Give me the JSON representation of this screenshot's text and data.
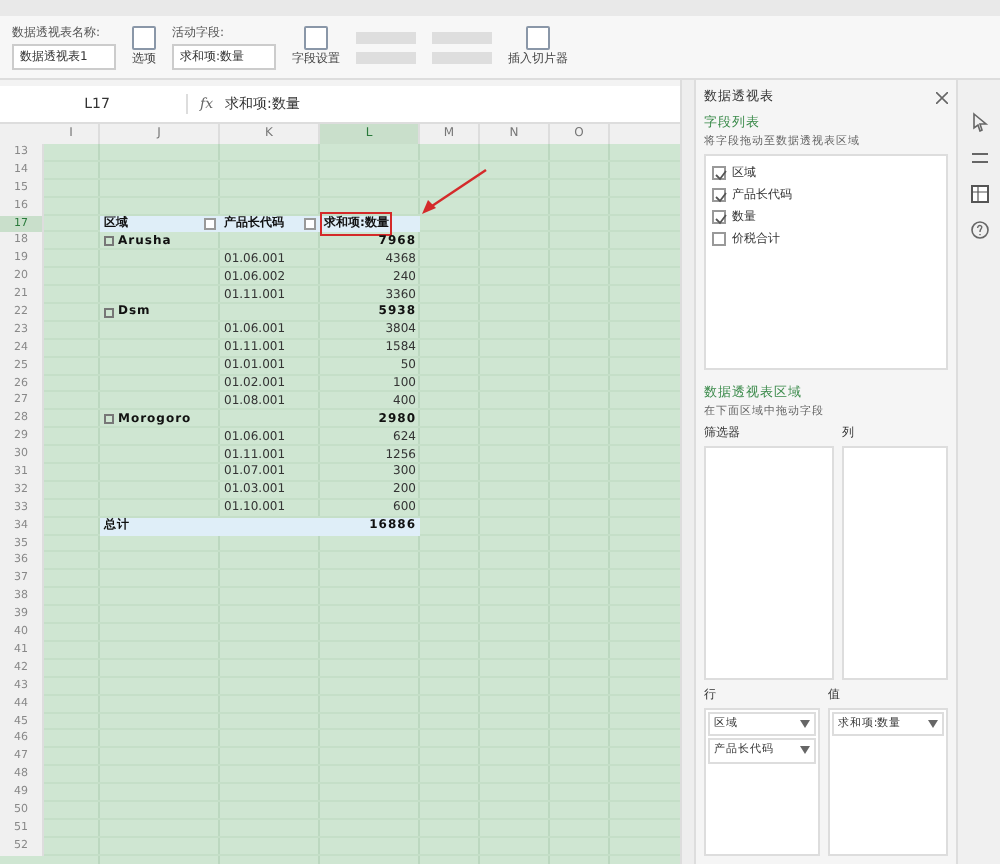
{
  "ribbon": {
    "pivot_name_label": "数据透视表名称:",
    "pivot_name": "数据透视表1",
    "options": "选项",
    "active_field_label": "活动字段:",
    "active_field": "求和项:数量",
    "field_settings": "字段设置",
    "insert_slicer": "插入切片器"
  },
  "formula_bar": {
    "name_box": "L17",
    "fx": "fx",
    "formula": "求和项:数量"
  },
  "columns": [
    {
      "label": "I",
      "selected": false
    },
    {
      "label": "J",
      "selected": false
    },
    {
      "label": "K",
      "selected": false
    },
    {
      "label": "L",
      "selected": true
    },
    {
      "label": "M",
      "selected": false
    },
    {
      "label": "N",
      "selected": false
    },
    {
      "label": "O",
      "selected": false
    }
  ],
  "rows": [
    {
      "number": "13",
      "selected": false
    },
    {
      "number": "14",
      "selected": false
    },
    {
      "number": "15",
      "selected": false
    },
    {
      "number": "16",
      "selected": false
    },
    {
      "number": "17",
      "selected": true,
      "kind": "header",
      "cells": [
        {
          "text": "区域",
          "dropdown": true,
          "highlighted": false
        },
        {
          "text": "产品长代码",
          "dropdown": true,
          "highlighted": false
        },
        {
          "text": "求和项:数量",
          "dropdown": false,
          "highlighted": true
        }
      ]
    },
    {
      "number": "18",
      "selected": false,
      "kind": "group",
      "label": "Arusha",
      "value": "7968"
    },
    {
      "number": "19",
      "selected": false,
      "kind": "item",
      "code": "01.06.001",
      "value": "4368"
    },
    {
      "number": "20",
      "selected": false,
      "kind": "item",
      "code": "01.06.002",
      "value": "240"
    },
    {
      "number": "21",
      "selected": false,
      "kind": "item",
      "code": "01.11.001",
      "value": "3360"
    },
    {
      "number": "22",
      "selected": false,
      "kind": "group",
      "label": "Dsm",
      "value": "5938"
    },
    {
      "number": "23",
      "selected": false,
      "kind": "item",
      "code": "01.06.001",
      "value": "3804"
    },
    {
      "number": "24",
      "selected": false,
      "kind": "item",
      "code": "01.11.001",
      "value": "1584"
    },
    {
      "number": "25",
      "selected": false,
      "kind": "item",
      "code": "01.01.001",
      "value": "50"
    },
    {
      "number": "26",
      "selected": false,
      "kind": "item",
      "code": "01.02.001",
      "value": "100"
    },
    {
      "number": "27",
      "selected": false,
      "kind": "item",
      "code": "01.08.001",
      "value": "400"
    },
    {
      "number": "28",
      "selected": false,
      "kind": "group",
      "label": "Morogoro",
      "value": "2980"
    },
    {
      "number": "29",
      "selected": false,
      "kind": "item",
      "code": "01.06.001",
      "value": "624"
    },
    {
      "number": "30",
      "selected": false,
      "kind": "item",
      "code": "01.11.001",
      "value": "1256"
    },
    {
      "number": "31",
      "selected": false,
      "kind": "item",
      "code": "01.07.001",
      "value": "300"
    },
    {
      "number": "32",
      "selected": false,
      "kind": "item",
      "code": "01.03.001",
      "value": "200"
    },
    {
      "number": "33",
      "selected": false,
      "kind": "item",
      "code": "01.10.001",
      "value": "600"
    },
    {
      "number": "34",
      "selected": false,
      "kind": "total",
      "label": "总计",
      "value": "16886"
    },
    {
      "number": "35",
      "selected": false
    },
    {
      "number": "36",
      "selected": false
    },
    {
      "number": "37",
      "selected": false
    },
    {
      "number": "38",
      "selected": false
    },
    {
      "number": "39",
      "selected": false
    },
    {
      "number": "40",
      "selected": false
    },
    {
      "number": "41",
      "selected": false
    },
    {
      "number": "42",
      "selected": false
    },
    {
      "number": "43",
      "selected": false
    },
    {
      "number": "44",
      "selected": false
    },
    {
      "number": "45",
      "selected": false
    },
    {
      "number": "46",
      "selected": false
    },
    {
      "number": "47",
      "selected": false
    },
    {
      "number": "48",
      "selected": false
    },
    {
      "number": "49",
      "selected": false
    },
    {
      "number": "50",
      "selected": false
    },
    {
      "number": "51",
      "selected": false
    },
    {
      "number": "52",
      "selected": false
    }
  ],
  "pane": {
    "title": "数据透视表",
    "field_list_title": "字段列表",
    "field_list_hint": "将字段拖动至数据透视表区域",
    "fields": [
      {
        "label": "区域",
        "checked": true
      },
      {
        "label": "产品长代码",
        "checked": true
      },
      {
        "label": "数量",
        "checked": true
      },
      {
        "label": "价税合计",
        "checked": false
      }
    ],
    "areas_title": "数据透视表区域",
    "areas_hint": "在下面区域中拖动字段",
    "filter_label": "筛选器",
    "column_label": "列",
    "row_label": "行",
    "value_label": "值",
    "row_fields": [
      "区域",
      "产品长代码"
    ],
    "value_fields": [
      "求和项:数量"
    ]
  }
}
